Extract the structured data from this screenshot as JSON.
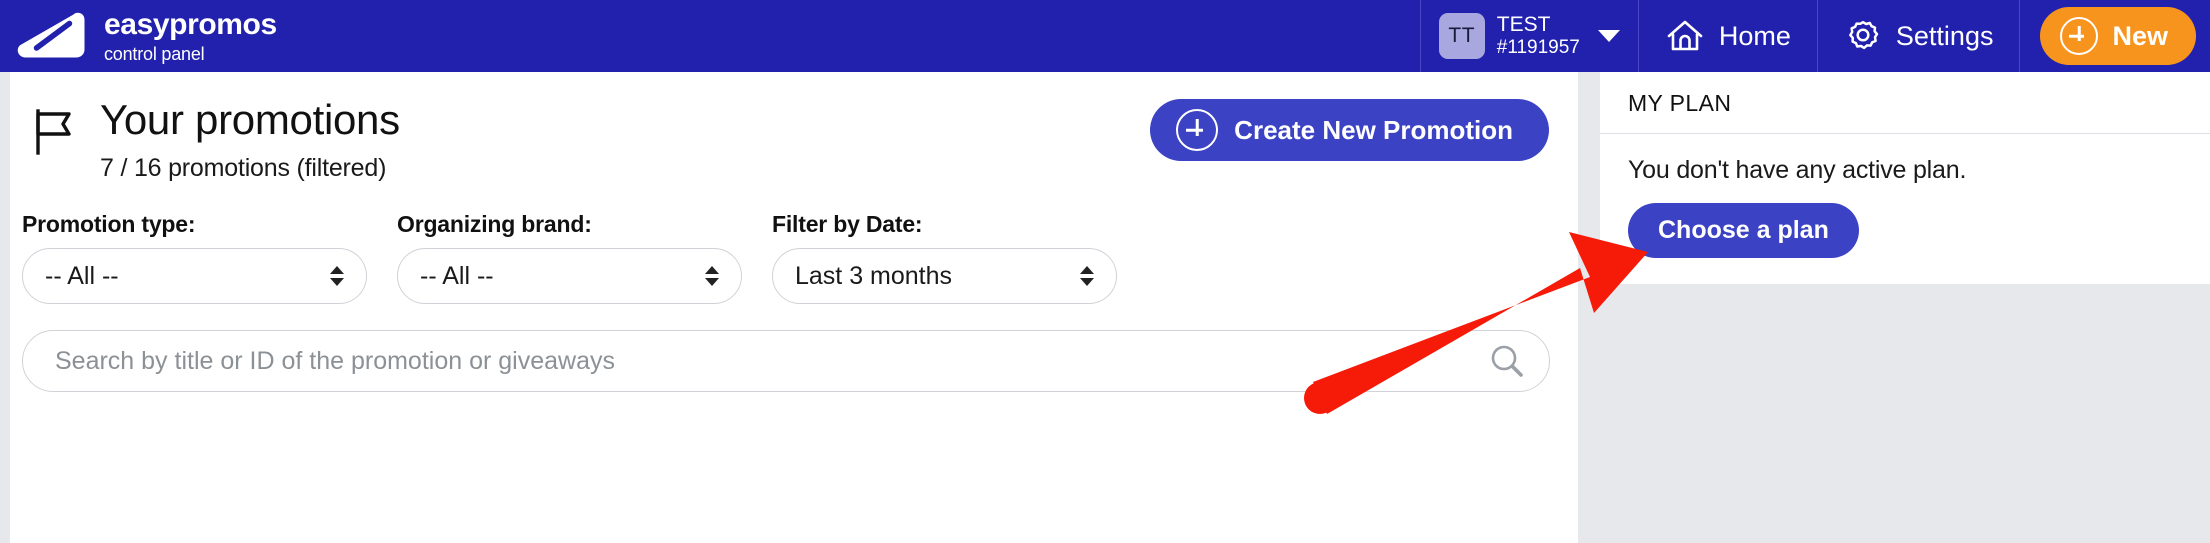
{
  "navbar": {
    "logo_icon": "easypromos-triangle-logo",
    "brand_name": "easypromos",
    "brand_subtitle": "control panel",
    "account": {
      "avatar_initials": "TT",
      "name": "TEST",
      "id": "#1191957",
      "caret_icon": "chevron-down-icon"
    },
    "links": [
      {
        "label": "Home",
        "icon": "home-icon"
      },
      {
        "label": "Settings",
        "icon": "gear-icon"
      }
    ],
    "new_button": {
      "label": "New",
      "icon": "plus-circle-icon"
    },
    "background_color": "#2221ad",
    "new_button_color": "#f7941d"
  },
  "main": {
    "flag_icon": "flag-icon",
    "title": "Your promotions",
    "subtitle": "7 / 16 promotions (filtered)",
    "create_button": {
      "label": "Create New Promotion",
      "icon": "plus-circle-icon",
      "color": "#3b42c4"
    },
    "filters": [
      {
        "label": "Promotion type:",
        "value": "-- All --",
        "name": "promotion-type"
      },
      {
        "label": "Organizing brand:",
        "value": "-- All --",
        "name": "organizing-brand"
      },
      {
        "label": "Filter by Date:",
        "value": "Last 3 months",
        "name": "filter-by-date"
      }
    ],
    "search": {
      "value": "",
      "placeholder": "Search by title or ID of the promotion or giveaways",
      "icon": "search-icon"
    }
  },
  "right_panel": {
    "card_title": "MY PLAN",
    "message": "You don't have any active plan.",
    "choose_plan_button": {
      "label": "Choose a plan",
      "color": "#3b42c4"
    }
  },
  "annotation": {
    "arrow_color": "#f61a09",
    "points_to": "choose-a-plan-button"
  }
}
